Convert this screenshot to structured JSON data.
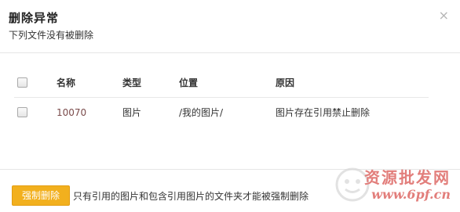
{
  "dialog": {
    "title": "删除异常",
    "subtitle": "下列文件没有被删除",
    "close_glyph": "×"
  },
  "table": {
    "headers": [
      "名称",
      "类型",
      "位置",
      "原因"
    ],
    "rows": [
      {
        "name": "10070",
        "type": "图片",
        "location": "/我的图片/",
        "reason": "图片存在引用禁止删除"
      }
    ]
  },
  "footer": {
    "force_delete_label": "强制删除",
    "note": "只有引用的图片和包含引用图片的文件夹才能被强制删除"
  },
  "watermark": {
    "line1": "资源批发网",
    "line2": "www.6pf.cn"
  },
  "colors": {
    "accent": "#f2b01e",
    "name_link": "#7a4a4a",
    "watermark": "#d9534f"
  }
}
